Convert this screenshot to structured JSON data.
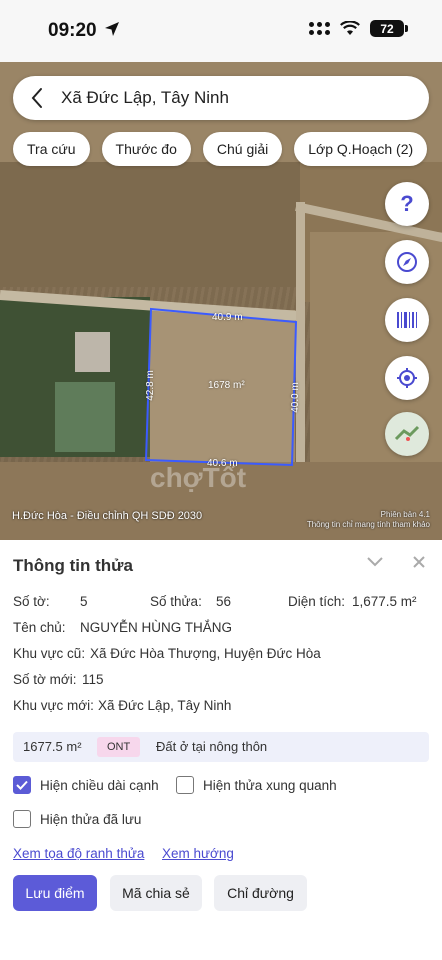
{
  "status_bar": {
    "time": "09:20",
    "battery": "72"
  },
  "search": {
    "location": "Xã Đức Lập, Tây Ninh"
  },
  "chips": [
    "Tra cứu",
    "Thước đo",
    "Chú giải",
    "Lớp Q.Hoạch (2)"
  ],
  "map": {
    "edge_top": "40.9 m",
    "edge_left": "42.8 m",
    "edge_right": "40.0 m",
    "edge_bottom": "40.6 m",
    "parcel_area": "1678 m²",
    "footer_left": "H.Đức Hòa - Điều chỉnh QH SDĐ 2030",
    "footer_right_version": "Phiên bản 4.1",
    "footer_right_note": "Thông tin chỉ mang tính tham khảo",
    "watermark": "chợTốt"
  },
  "panel": {
    "title": "Thông tin thửa",
    "so_to_label": "Số tờ:",
    "so_to_value": "5",
    "so_thua_label": "Số thửa:",
    "so_thua_value": "56",
    "dien_tich_label": "Diện tích:",
    "dien_tich_value": "1,677.5 m²",
    "ten_chu_label": "Tên chủ:",
    "ten_chu_value": "NGUYỄN HÙNG THẮNG",
    "khu_vuc_cu_label": "Khu vực cũ:",
    "khu_vuc_cu_value": "Xã Đức Hòa Thượng, Huyện Đức Hòa",
    "so_to_moi_label": "Số tờ mới:",
    "so_to_moi_value": "115",
    "khu_vuc_moi_label": "Khu vực mới:",
    "khu_vuc_moi_value": "Xã Đức Lập, Tây Ninh",
    "land_area": "1677.5 m²",
    "land_code": "ONT",
    "land_desc": "Đất ở tại nông thôn",
    "opt_edge_length": "Hiện chiều dài cạnh",
    "opt_neighbors": "Hiện thửa xung quanh",
    "opt_saved": "Hiện thửa đã lưu",
    "link_coords": "Xem tọa độ ranh thửa",
    "link_direction": "Xem hướng",
    "btn_save": "Lưu điểm",
    "btn_share": "Mã chia sẻ",
    "btn_directions": "Chỉ đường"
  },
  "checkbox_state": {
    "edge_length": true,
    "neighbors": false,
    "saved": false
  },
  "colors": {
    "accent": "#5c5bd8",
    "parcel_outline": "#3b5bff",
    "tag_bg": "#f7d7ec"
  }
}
